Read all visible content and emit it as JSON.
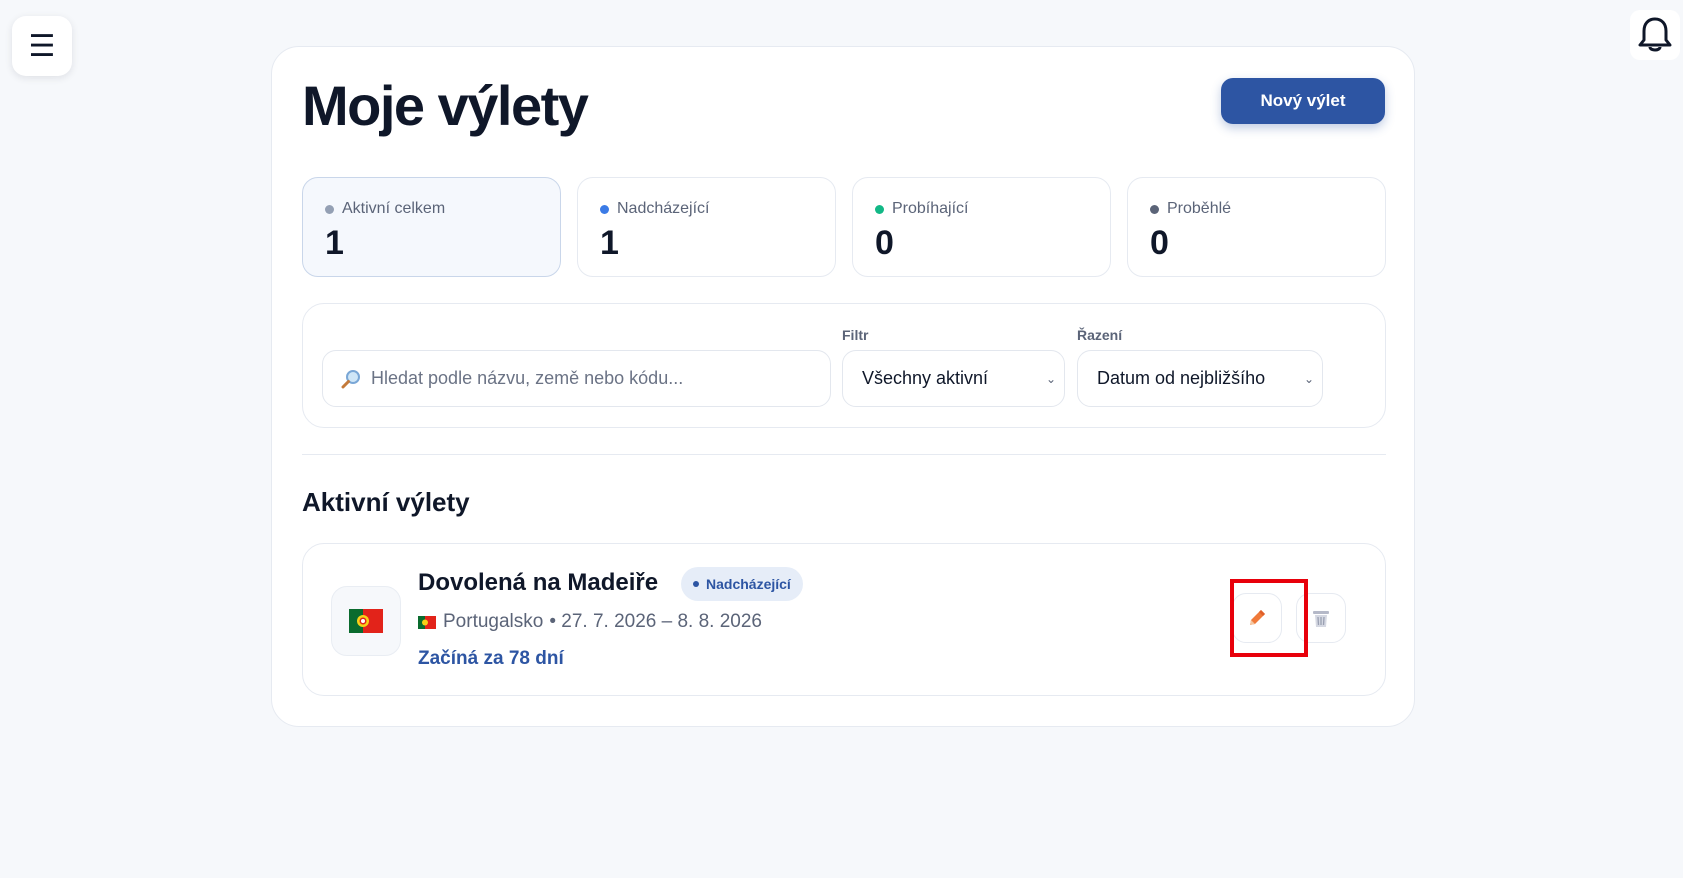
{
  "header": {
    "menu_icon": "hamburger-icon",
    "notification_icon": "bell-icon"
  },
  "page": {
    "title": "Moje výlety",
    "new_trip_label": "Nový výlet"
  },
  "stats": [
    {
      "label": "Aktivní celkem",
      "value": "1",
      "dot_color": "#94a0b4"
    },
    {
      "label": "Nadcházející",
      "value": "1",
      "dot_color": "#3b7be6"
    },
    {
      "label": "Probíhající",
      "value": "0",
      "dot_color": "#12b886"
    },
    {
      "label": "Proběhlé",
      "value": "0",
      "dot_color": "#5b6478"
    }
  ],
  "filters": {
    "search_placeholder": "Hledat podle názvu, země nebo kódu...",
    "filter_label": "Filtr",
    "filter_value": "Všechny aktivní",
    "sort_label": "Řazení",
    "sort_value": "Datum od nejbližšího"
  },
  "section": {
    "title": "Aktivní výlety"
  },
  "trips": [
    {
      "name": "Dovolená na Madeiře",
      "status": "Nadcházející",
      "country": "Portugalsko",
      "dates": "• 27. 7. 2026 – 8. 8. 2026",
      "countdown": "Začíná za 78 dní",
      "flag_icon": "portugal-flag-icon"
    }
  ],
  "colors": {
    "accent": "#2d55a3",
    "edit_icon": "#f07a3a",
    "highlight": "#e8000b"
  }
}
